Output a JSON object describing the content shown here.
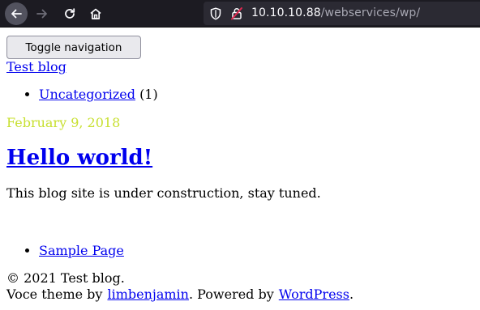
{
  "browser": {
    "url_host": "10.10.10.88",
    "url_path": "/webservices/wp/"
  },
  "page": {
    "toggle_label": "Toggle navigation",
    "brand": "Test blog",
    "categories": [
      {
        "name": "Uncategorized",
        "count": "(1)"
      }
    ],
    "post": {
      "date": "February 9, 2018",
      "title": "Hello world!",
      "body": "This blog site is under construction, stay tuned."
    },
    "pages": [
      {
        "name": "Sample Page"
      }
    ],
    "footer": {
      "copyright": "© 2021 Test blog.",
      "theme_prefix": "Voce theme by",
      "theme_author": "limbenjamin",
      "powered_prefix": ".  Powered by",
      "powered_link": "WordPress",
      "end": "."
    },
    "colors": {
      "link": "#0000ee",
      "date": "#c8e031",
      "toolbar": "#1c1b22"
    }
  }
}
